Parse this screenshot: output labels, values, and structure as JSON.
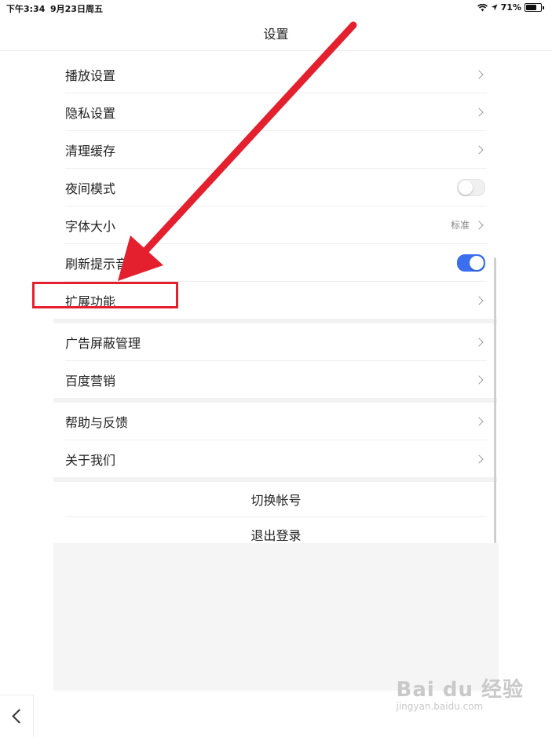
{
  "status_bar": {
    "time": "下午3:34",
    "date": "9月23日周五",
    "battery": "71%"
  },
  "nav": {
    "title": "设置"
  },
  "settings_rows": [
    {
      "label": "播放设置",
      "type": "chevron"
    },
    {
      "label": "隐私设置",
      "type": "chevron"
    },
    {
      "label": "清理缓存",
      "type": "chevron"
    },
    {
      "label": "夜间模式",
      "type": "toggle",
      "on": false
    },
    {
      "label": "字体大小",
      "type": "chevron",
      "value": "标准"
    },
    {
      "label": "刷新提示音",
      "type": "toggle",
      "on": true
    },
    {
      "label": "扩展功能",
      "type": "chevron"
    }
  ],
  "group2_rows": [
    {
      "label": "广告屏蔽管理"
    },
    {
      "label": "百度营销"
    }
  ],
  "group3_rows": [
    {
      "label": "帮助与反馈"
    },
    {
      "label": "关于我们"
    }
  ],
  "account": {
    "switch_label": "切换帐号",
    "logout_label": "退出登录"
  },
  "annotation": {
    "color": "#e4202e",
    "target": "扩展功能"
  },
  "colors": {
    "toggle_on": "#3b6ff0",
    "highlight": "#e4202e"
  },
  "watermark": {
    "main": "Bai du 经验",
    "sub": "jingyan.baidu.com"
  }
}
